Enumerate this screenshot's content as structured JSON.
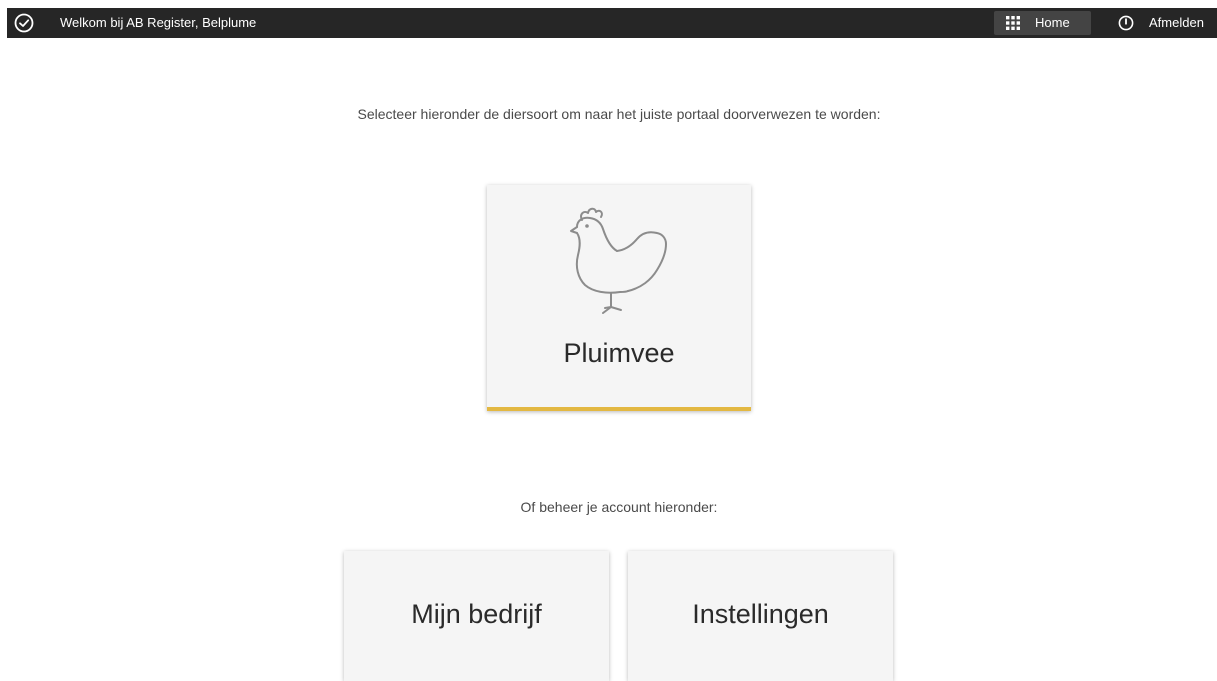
{
  "topbar": {
    "welcome_text": "Welkom bij AB Register, Belplume",
    "welcome_icon": "check-circle-icon",
    "home_label": "Home",
    "home_icon": "grid-icon",
    "logout_label": "Afmelden",
    "logout_icon": "power-icon",
    "background_color": "#262626"
  },
  "main": {
    "intro_text": "Selecteer hieronder de diersoort om naar het juiste portaal doorverwezen te worden:",
    "species_tiles": [
      {
        "label": "Pluimvee",
        "icon": "chicken-icon",
        "accent_color": "#e3b842"
      }
    ],
    "account_intro": "Of beheer je account hieronder:",
    "account_tiles": [
      {
        "label": "Mijn bedrijf"
      },
      {
        "label": "Instellingen"
      }
    ]
  }
}
